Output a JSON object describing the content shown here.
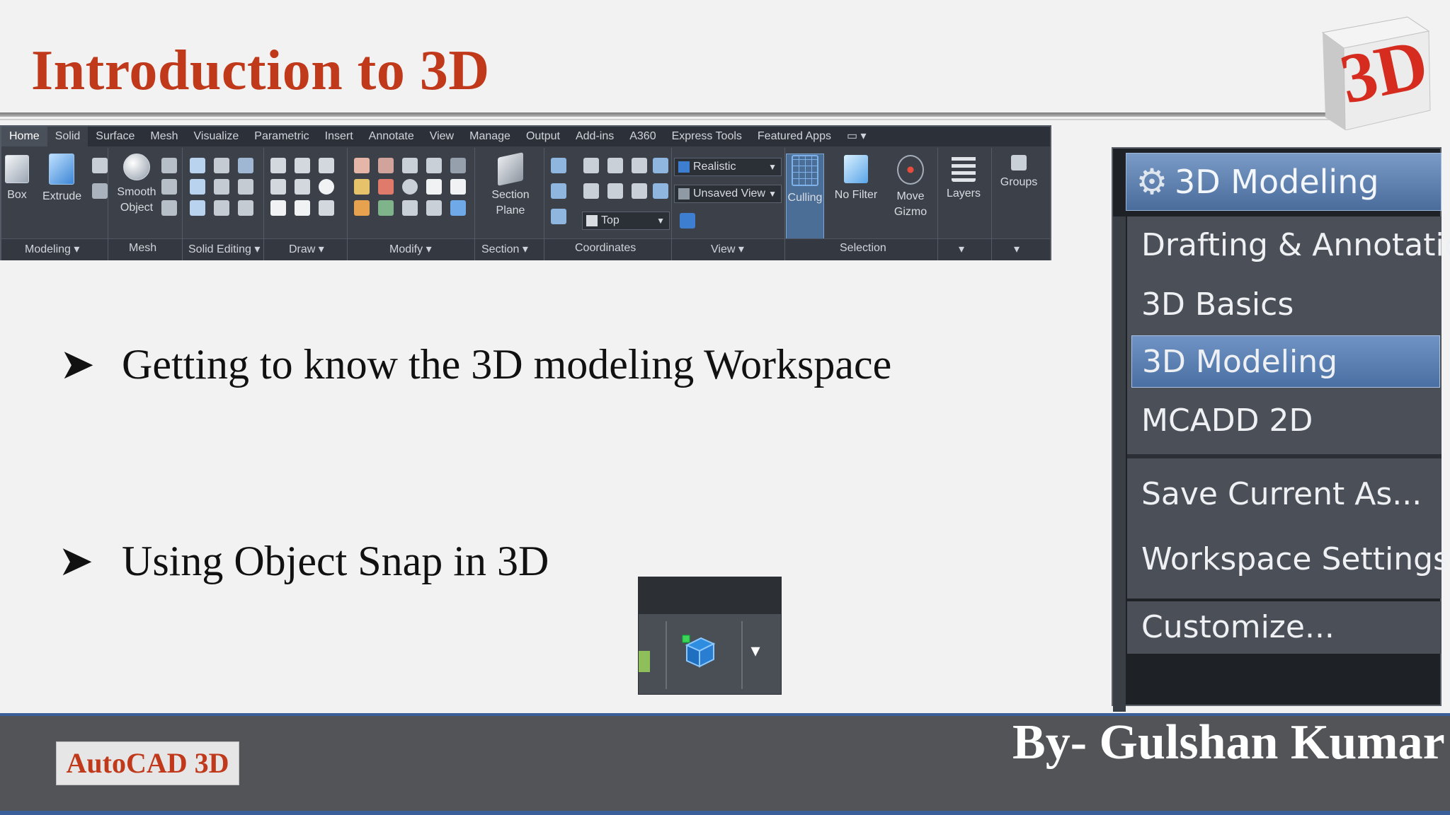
{
  "slide": {
    "title": "Introduction to 3D",
    "logo_text": "3D",
    "bullets": [
      "Getting to know the 3D modeling Workspace",
      "Using Object Snap in 3D"
    ]
  },
  "ribbon": {
    "tabs": [
      "Home",
      "Solid",
      "Surface",
      "Mesh",
      "Visualize",
      "Parametric",
      "Insert",
      "Annotate",
      "View",
      "Manage",
      "Output",
      "Add-ins",
      "A360",
      "Express Tools",
      "Featured Apps"
    ],
    "active_tab": "Home",
    "tools": {
      "box": "Box",
      "extrude": "Extrude",
      "smooth_line1": "Smooth",
      "smooth_line2": "Object",
      "section_line1": "Section",
      "section_line2": "Plane",
      "culling": "Culling",
      "no_filter": "No Filter",
      "move_line1": "Move",
      "move_line2": "Gizmo",
      "layers": "Layers",
      "groups": "Groups"
    },
    "dropdowns": {
      "visual_style": "Realistic",
      "view": "Unsaved View",
      "viewport": "Top"
    },
    "panels": [
      "Modeling ▾",
      "Mesh",
      "Solid Editing ▾",
      "Draw ▾",
      "Modify ▾",
      "Section ▾",
      "Coordinates",
      "View ▾",
      "Selection"
    ],
    "colors": {
      "background": "#3b4049",
      "tabbar": "#2c3038",
      "highlight": "#4b6e96"
    }
  },
  "workspace_menu": {
    "current": "3D Modeling",
    "items": [
      "Drafting & Annotation",
      "3D Basics",
      "3D Modeling",
      "MCADD 2D"
    ],
    "selected": "3D Modeling",
    "actions": [
      "Save Current As...",
      "Workspace Settings...",
      "Customize..."
    ],
    "icon": "gear-icon"
  },
  "footer": {
    "tag": "AutoCAD 3D",
    "author": "By- Gulshan Kumar"
  },
  "colors": {
    "title": "#c0391b",
    "footer": "#525458",
    "footer_accent": "#3b5f98"
  }
}
